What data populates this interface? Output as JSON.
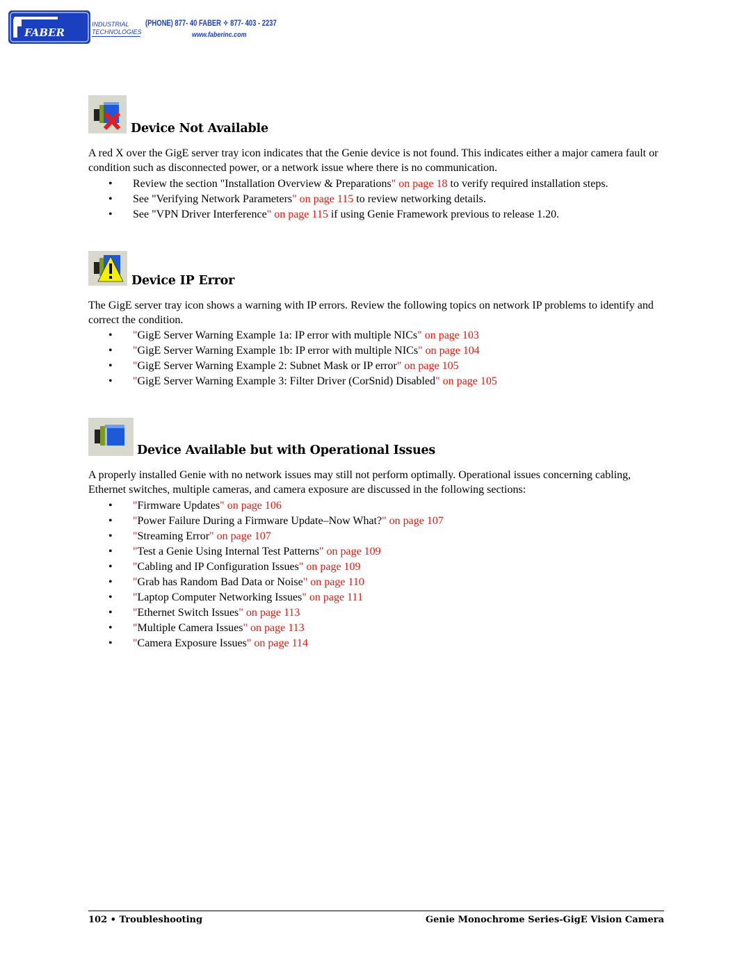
{
  "header": {
    "logo_text": "FABER",
    "logo_sub_1": "INDUSTRIAL",
    "logo_sub_2": "TECHNOLOGIES",
    "phone": "(PHONE) 877- 40 FABER ✧ 877- 403 - 2237",
    "website": "www.faberinc.com",
    "brand_color": "#1a3fbf"
  },
  "sections": [
    {
      "icon": "camera-red-x-icon",
      "title": "Device Not Available",
      "paragraph": "A red X over the GigE server tray icon indicates that the Genie device is not found. This indicates either a major camera fault or condition such as disconnected power, or a network issue where there is no communication.",
      "bullets": [
        {
          "pre": "Review the section \"Installation Overview & Preparations",
          "link": "\" on page 18",
          "post": " to verify required installation steps."
        },
        {
          "pre": "See \"Verifying Network Parameters",
          "link": "\" on page 115",
          "post": " to review networking details."
        },
        {
          "pre": "See \"VPN Driver Interference",
          "link": "\" on page 115",
          "post": " if using Genie Framework previous to release 1.20."
        }
      ]
    },
    {
      "icon": "camera-warning-icon",
      "title": "Device IP Error",
      "paragraph": "The GigE server tray icon shows a warning with IP errors. Review the following topics on network IP problems to identify and correct the condition.",
      "bullets": [
        {
          "q": "\"",
          "text": "GigE Server Warning Example 1a: IP error with multiple NICs",
          "link": "\" on page 103"
        },
        {
          "q": "\"",
          "text": "GigE Server Warning Example 1b: IP error with multiple NICs",
          "link": "\" on page 104"
        },
        {
          "q": "\"",
          "text": "GigE Server Warning Example 2: Subnet Mask or IP error",
          "link": "\" on page 105"
        },
        {
          "q": "\"",
          "text": "GigE Server Warning Example 3: Filter Driver (CorSnid) Disabled",
          "link": "\" on page 105"
        }
      ]
    },
    {
      "icon": "camera-ok-icon",
      "title": "Device Available but with Operational Issues",
      "paragraph": "A properly installed Genie with no network issues may still not perform optimally. Operational issues concerning cabling, Ethernet switches, multiple cameras, and camera exposure are discussed in the following sections:",
      "bullets": [
        {
          "q": "\"",
          "text": "Firmware Updates",
          "link": "\" on page 106"
        },
        {
          "q": "\"",
          "text": "Power Failure During a Firmware Update–Now What?",
          "link": "\" on page 107"
        },
        {
          "q": "\"",
          "text": "Streaming Error",
          "link": "\" on page 107"
        },
        {
          "q": "\"",
          "text": "Test a Genie Using Internal Test Patterns",
          "link": "\" on page 109"
        },
        {
          "q": "\"",
          "text": "Cabling and IP Configuration Issues",
          "link": "\" on page 109"
        },
        {
          "q": "\"",
          "text": "Grab has Random Bad Data or Noise",
          "link": "\" on page 110"
        },
        {
          "q": "\"",
          "text": "Laptop Computer Networking Issues",
          "link": "\" on page 111"
        },
        {
          "q": "\"",
          "text": "Ethernet Switch Issues",
          "link": "\" on page 113"
        },
        {
          "q": "\"",
          "text": "Multiple Camera Issues",
          "link": "\" on page 113"
        },
        {
          "q": "\"",
          "text": "Camera Exposure Issues",
          "link": "\" on page 114"
        }
      ]
    }
  ],
  "bullet_char": "•",
  "link_color": "#e8170f",
  "footer": {
    "left": "102 • Troubleshooting",
    "right": "Genie Monochrome Series-GigE Vision Camera"
  }
}
